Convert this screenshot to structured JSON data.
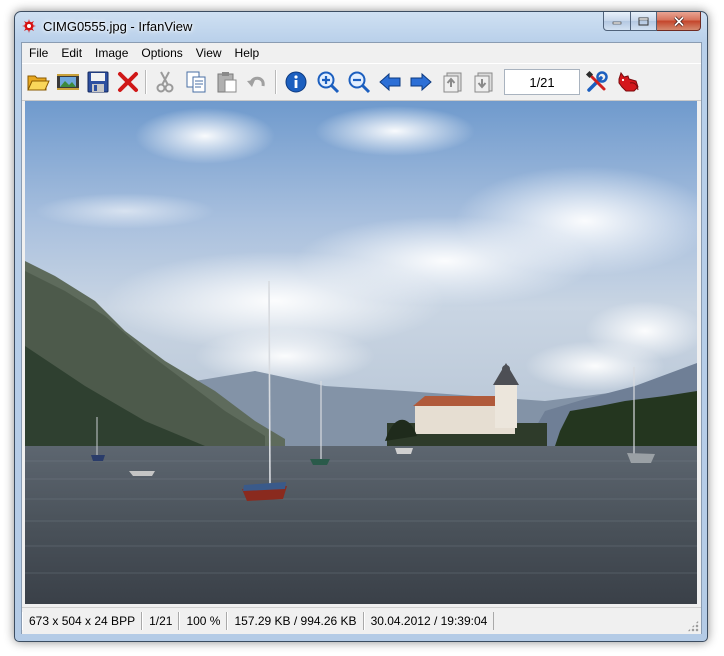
{
  "window": {
    "title": "CIMG0555.jpg - IrfanView"
  },
  "menu": [
    "File",
    "Edit",
    "Image",
    "Options",
    "View",
    "Help"
  ],
  "toolbar": {
    "buttons": [
      {
        "name": "open-folder-icon"
      },
      {
        "name": "slideshow-icon"
      },
      {
        "name": "save-icon"
      },
      {
        "name": "delete-icon"
      },
      {
        "name": "cut-icon"
      },
      {
        "name": "copy-icon"
      },
      {
        "name": "paste-icon"
      },
      {
        "name": "undo-icon"
      },
      {
        "name": "info-icon"
      },
      {
        "name": "zoom-in-icon"
      },
      {
        "name": "zoom-out-icon"
      },
      {
        "name": "previous-arrow-icon"
      },
      {
        "name": "next-arrow-icon"
      },
      {
        "name": "first-page-icon"
      },
      {
        "name": "last-page-icon"
      },
      {
        "name": "settings-tools-icon"
      },
      {
        "name": "irfanview-cat-icon"
      }
    ],
    "page_indicator": "1/21"
  },
  "status": {
    "dimensions": "673 x 504 x 24 BPP",
    "page": "1/21",
    "zoom": "100 %",
    "size": "157.29 KB / 994.26 KB",
    "datetime": "30.04.2012 / 19:39:04"
  },
  "colors": {
    "accent": "#1c5fbf",
    "close_button": "#c4452b",
    "delete_red": "#d01818"
  }
}
